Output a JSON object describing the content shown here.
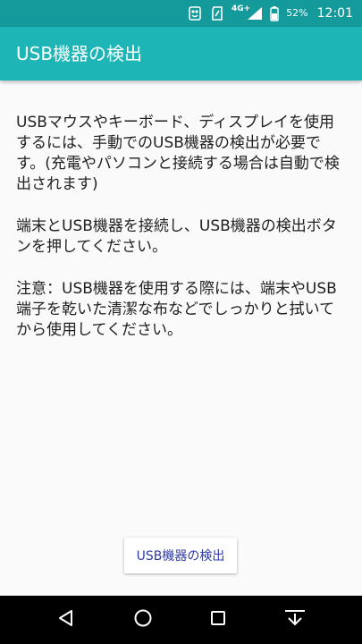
{
  "status_bar": {
    "network": "4G+",
    "battery_percent": "52%",
    "time": "12:01",
    "icons": [
      "sim-card-icon",
      "sd-card-icon",
      "signal-icon",
      "battery-icon"
    ]
  },
  "app_bar": {
    "title": "USB機器の検出"
  },
  "content": {
    "paragraphs": [
      "USBマウスやキーボード、ディスプレイを使用するには、手動でのUSB機器の検出が必要です。(充電やパソコンと接続する場合は自動で検出されます)",
      "端末とUSB機器を接続し、USB機器の検出ボタンを押してください。",
      "注意：USB機器を使用する際には、端末やUSB端子を乾いた清潔な布などでしっかりと拭いてから使用してください。"
    ]
  },
  "button": {
    "label": "USB機器の検出"
  },
  "nav_bar": {
    "icons": [
      "back-icon",
      "home-icon",
      "recents-icon",
      "notification-pull-icon"
    ]
  },
  "colors": {
    "status_bar": "#149a9a",
    "app_bar": "#1db5b5",
    "button_text": "#2d3aa8"
  }
}
